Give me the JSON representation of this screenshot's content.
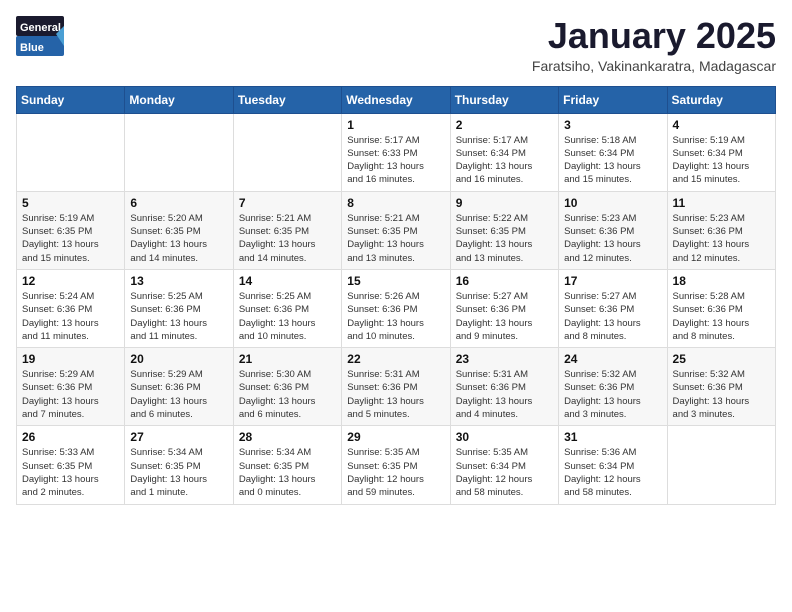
{
  "header": {
    "logo_general": "General",
    "logo_blue": "Blue",
    "month_title": "January 2025",
    "location": "Faratsiho, Vakinankaratra, Madagascar"
  },
  "weekdays": [
    "Sunday",
    "Monday",
    "Tuesday",
    "Wednesday",
    "Thursday",
    "Friday",
    "Saturday"
  ],
  "weeks": [
    [
      {
        "day": "",
        "info": ""
      },
      {
        "day": "",
        "info": ""
      },
      {
        "day": "",
        "info": ""
      },
      {
        "day": "1",
        "info": "Sunrise: 5:17 AM\nSunset: 6:33 PM\nDaylight: 13 hours\nand 16 minutes."
      },
      {
        "day": "2",
        "info": "Sunrise: 5:17 AM\nSunset: 6:34 PM\nDaylight: 13 hours\nand 16 minutes."
      },
      {
        "day": "3",
        "info": "Sunrise: 5:18 AM\nSunset: 6:34 PM\nDaylight: 13 hours\nand 15 minutes."
      },
      {
        "day": "4",
        "info": "Sunrise: 5:19 AM\nSunset: 6:34 PM\nDaylight: 13 hours\nand 15 minutes."
      }
    ],
    [
      {
        "day": "5",
        "info": "Sunrise: 5:19 AM\nSunset: 6:35 PM\nDaylight: 13 hours\nand 15 minutes."
      },
      {
        "day": "6",
        "info": "Sunrise: 5:20 AM\nSunset: 6:35 PM\nDaylight: 13 hours\nand 14 minutes."
      },
      {
        "day": "7",
        "info": "Sunrise: 5:21 AM\nSunset: 6:35 PM\nDaylight: 13 hours\nand 14 minutes."
      },
      {
        "day": "8",
        "info": "Sunrise: 5:21 AM\nSunset: 6:35 PM\nDaylight: 13 hours\nand 13 minutes."
      },
      {
        "day": "9",
        "info": "Sunrise: 5:22 AM\nSunset: 6:35 PM\nDaylight: 13 hours\nand 13 minutes."
      },
      {
        "day": "10",
        "info": "Sunrise: 5:23 AM\nSunset: 6:36 PM\nDaylight: 13 hours\nand 12 minutes."
      },
      {
        "day": "11",
        "info": "Sunrise: 5:23 AM\nSunset: 6:36 PM\nDaylight: 13 hours\nand 12 minutes."
      }
    ],
    [
      {
        "day": "12",
        "info": "Sunrise: 5:24 AM\nSunset: 6:36 PM\nDaylight: 13 hours\nand 11 minutes."
      },
      {
        "day": "13",
        "info": "Sunrise: 5:25 AM\nSunset: 6:36 PM\nDaylight: 13 hours\nand 11 minutes."
      },
      {
        "day": "14",
        "info": "Sunrise: 5:25 AM\nSunset: 6:36 PM\nDaylight: 13 hours\nand 10 minutes."
      },
      {
        "day": "15",
        "info": "Sunrise: 5:26 AM\nSunset: 6:36 PM\nDaylight: 13 hours\nand 10 minutes."
      },
      {
        "day": "16",
        "info": "Sunrise: 5:27 AM\nSunset: 6:36 PM\nDaylight: 13 hours\nand 9 minutes."
      },
      {
        "day": "17",
        "info": "Sunrise: 5:27 AM\nSunset: 6:36 PM\nDaylight: 13 hours\nand 8 minutes."
      },
      {
        "day": "18",
        "info": "Sunrise: 5:28 AM\nSunset: 6:36 PM\nDaylight: 13 hours\nand 8 minutes."
      }
    ],
    [
      {
        "day": "19",
        "info": "Sunrise: 5:29 AM\nSunset: 6:36 PM\nDaylight: 13 hours\nand 7 minutes."
      },
      {
        "day": "20",
        "info": "Sunrise: 5:29 AM\nSunset: 6:36 PM\nDaylight: 13 hours\nand 6 minutes."
      },
      {
        "day": "21",
        "info": "Sunrise: 5:30 AM\nSunset: 6:36 PM\nDaylight: 13 hours\nand 6 minutes."
      },
      {
        "day": "22",
        "info": "Sunrise: 5:31 AM\nSunset: 6:36 PM\nDaylight: 13 hours\nand 5 minutes."
      },
      {
        "day": "23",
        "info": "Sunrise: 5:31 AM\nSunset: 6:36 PM\nDaylight: 13 hours\nand 4 minutes."
      },
      {
        "day": "24",
        "info": "Sunrise: 5:32 AM\nSunset: 6:36 PM\nDaylight: 13 hours\nand 3 minutes."
      },
      {
        "day": "25",
        "info": "Sunrise: 5:32 AM\nSunset: 6:36 PM\nDaylight: 13 hours\nand 3 minutes."
      }
    ],
    [
      {
        "day": "26",
        "info": "Sunrise: 5:33 AM\nSunset: 6:35 PM\nDaylight: 13 hours\nand 2 minutes."
      },
      {
        "day": "27",
        "info": "Sunrise: 5:34 AM\nSunset: 6:35 PM\nDaylight: 13 hours\nand 1 minute."
      },
      {
        "day": "28",
        "info": "Sunrise: 5:34 AM\nSunset: 6:35 PM\nDaylight: 13 hours\nand 0 minutes."
      },
      {
        "day": "29",
        "info": "Sunrise: 5:35 AM\nSunset: 6:35 PM\nDaylight: 12 hours\nand 59 minutes."
      },
      {
        "day": "30",
        "info": "Sunrise: 5:35 AM\nSunset: 6:34 PM\nDaylight: 12 hours\nand 58 minutes."
      },
      {
        "day": "31",
        "info": "Sunrise: 5:36 AM\nSunset: 6:34 PM\nDaylight: 12 hours\nand 58 minutes."
      },
      {
        "day": "",
        "info": ""
      }
    ]
  ]
}
